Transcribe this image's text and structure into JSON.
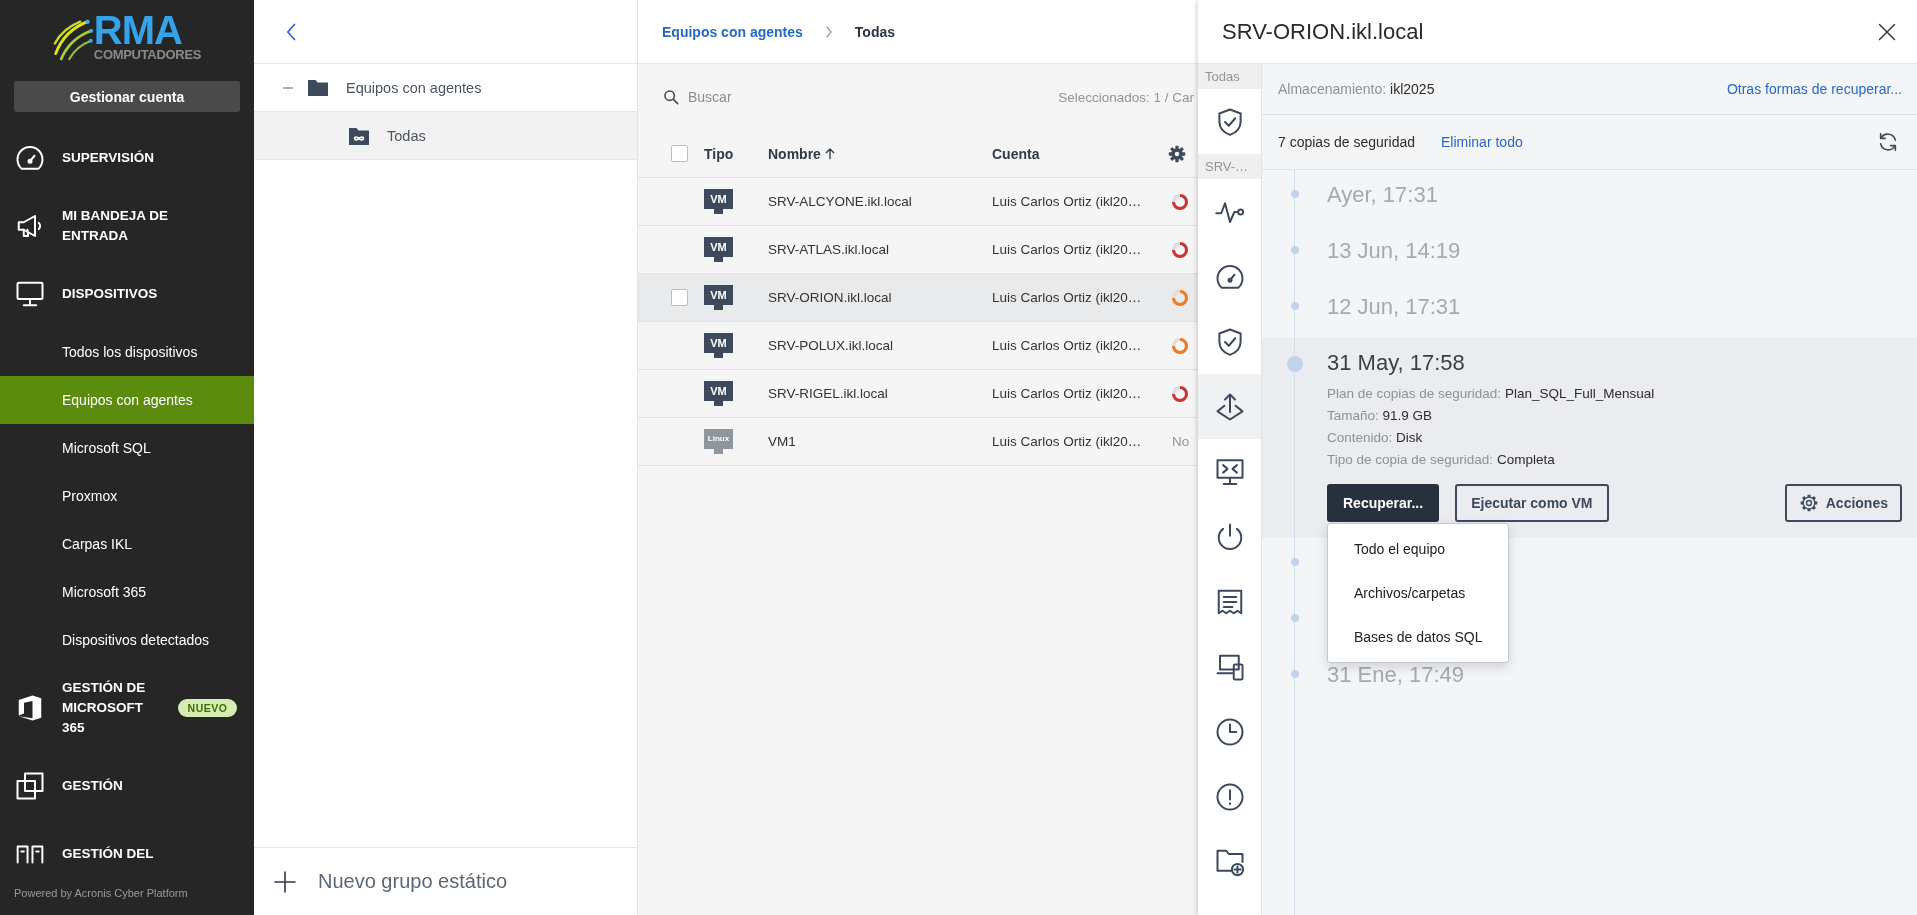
{
  "sidebar": {
    "logo": {
      "title": "RMA",
      "subtitle": "COMPUTADORES"
    },
    "account_button": "Gestionar cuenta",
    "items": [
      {
        "kind": "section",
        "label": "SUPERVISIÓN",
        "selected": false
      },
      {
        "kind": "section",
        "label": "MI BANDEJA DE ENTRADA",
        "selected": false
      },
      {
        "kind": "section",
        "label": "DISPOSITIVOS",
        "selected": false
      },
      {
        "kind": "sub",
        "label": "Todos los dispositivos",
        "selected": false
      },
      {
        "kind": "sub",
        "label": "Equipos con agentes",
        "selected": true
      },
      {
        "kind": "sub",
        "label": "Microsoft SQL",
        "selected": false
      },
      {
        "kind": "sub",
        "label": "Proxmox",
        "selected": false
      },
      {
        "kind": "sub",
        "label": "Carpas IKL",
        "selected": false
      },
      {
        "kind": "sub",
        "label": "Microsoft 365",
        "selected": false
      },
      {
        "kind": "sub",
        "label": "Dispositivos detectados",
        "selected": false
      },
      {
        "kind": "section",
        "label": "GESTIÓN DE MICROSOFT 365",
        "selected": false,
        "badge": "NUEVO"
      },
      {
        "kind": "section",
        "label": "GESTIÓN",
        "selected": false
      },
      {
        "kind": "section",
        "label": "GESTIÓN DEL",
        "selected": false
      }
    ],
    "footer": "Powered by Acronis Cyber Platform"
  },
  "tree": {
    "items": [
      {
        "label": "Equipos con agentes",
        "expanded": true,
        "selected": false,
        "children": [
          {
            "label": "Todas",
            "selected": true
          }
        ]
      }
    ],
    "new_group": "Nuevo grupo estático"
  },
  "main": {
    "breadcrumb": [
      "Equipos con agentes",
      "Todas"
    ],
    "search": {
      "placeholder": "Buscar"
    },
    "selection": "Seleccionados: 1 / Car",
    "table": {
      "select_all": {
        "checked": false
      },
      "columns": [
        {
          "label": "Tipo",
          "sorted": false
        },
        {
          "label": "Nombre",
          "sorted": true
        },
        {
          "label": "Cuenta",
          "sorted": false
        }
      ],
      "rows": [
        {
          "type": {
            "kind": "vm",
            "label": "VM"
          },
          "name": "SRV-ALCYONE.ikl.local",
          "account": "Luis Carlos Ortiz (ikl20…",
          "color": "#d0342c",
          "selected": false
        },
        {
          "type": {
            "kind": "vm",
            "label": "VM"
          },
          "name": "SRV-ATLAS.ikl.local",
          "account": "Luis Carlos Ortiz (ikl20…",
          "color": "#d0342c",
          "selected": false
        },
        {
          "type": {
            "kind": "vm",
            "label": "VM"
          },
          "name": "SRV-ORION.ikl.local",
          "account": "Luis Carlos Ortiz (ikl20…",
          "color": "#f2791f",
          "selected": true
        },
        {
          "type": {
            "kind": "vm",
            "label": "VM"
          },
          "name": "SRV-POLUX.ikl.local",
          "account": "Luis Carlos Ortiz (ikl20…",
          "color": "#f2791f",
          "selected": false
        },
        {
          "type": {
            "kind": "vm",
            "label": "VM"
          },
          "name": "SRV-RIGEL.ikl.local",
          "account": "Luis Carlos Ortiz (ikl20…",
          "color": "#d0342c",
          "selected": false
        },
        {
          "type": {
            "kind": "linux",
            "label": "Linux"
          },
          "name": "VM1",
          "account": "Luis Carlos Ortiz (ikl20…",
          "status": "No",
          "selected": false
        }
      ]
    }
  },
  "panel": {
    "title": "SRV-ORION.ikl.local",
    "rail": [
      {
        "label": "Todas",
        "items": [
          {
            "selected": false
          }
        ]
      },
      {
        "label": "SRV-…",
        "items": [
          {
            "selected": false
          },
          {
            "selected": false
          },
          {
            "selected": false
          },
          {
            "selected": true
          },
          {
            "selected": false
          },
          {
            "selected": false
          },
          {
            "selected": false
          },
          {
            "selected": false
          },
          {
            "selected": false
          },
          {
            "selected": false
          },
          {
            "selected": false
          }
        ]
      }
    ],
    "storage": {
      "label": "Almacenamiento:",
      "value": "ikl2025"
    },
    "other_ways_link": "Otras formas de recuperar...",
    "backups": {
      "count": "7 copias de seguridad",
      "delete_all": "Eliminar todo"
    },
    "timeline": [
      {
        "date": "Ayer, 17:31",
        "expanded": false
      },
      {
        "date": "13 Jun, 14:19",
        "expanded": false
      },
      {
        "date": "12 Jun, 17:31",
        "expanded": false
      },
      {
        "date": "31 May, 17:58",
        "expanded": true,
        "details": [
          {
            "label": "Plan de copias de seguridad:",
            "value": "Plan_SQL_Full_Mensual"
          },
          {
            "label": "Tamaño:",
            "value": "91.9 GB"
          },
          {
            "label": "Contenido:",
            "value": "Disk"
          },
          {
            "label": "Tipo de copia de seguridad:",
            "value": "Completa"
          }
        ],
        "buttons": [
          {
            "kind": "primary",
            "label": "Recuperar...",
            "menu": [
              "Todo el equipo",
              "Archivos/carpetas",
              "Bases de datos SQL"
            ]
          },
          {
            "kind": "secondary",
            "label": "Ejecutar como VM"
          },
          {
            "kind": "actions",
            "label": "Acciones"
          }
        ]
      },
      {
        "expanded": false
      },
      {
        "expanded": false
      },
      {
        "date": "31 Ene, 17:49",
        "expanded": false
      }
    ]
  }
}
